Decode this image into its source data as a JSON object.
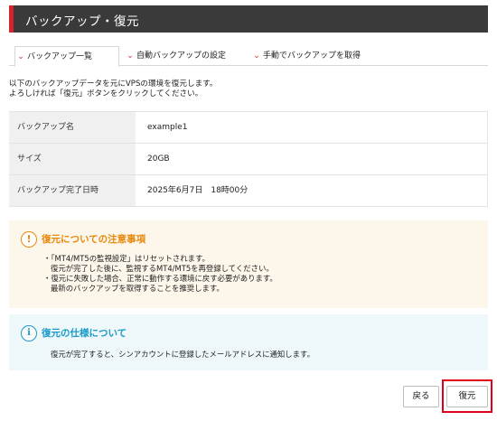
{
  "header": {
    "title": "バックアップ・復元"
  },
  "tabs": [
    {
      "label": "バックアップ一覧",
      "active": true
    },
    {
      "label": "自動バックアップの設定",
      "active": false
    },
    {
      "label": "手動でバックアップを取得",
      "active": false
    }
  ],
  "intro": {
    "line1": "以下のバックアップデータを元にVPSの環境を復元します。",
    "line2": "よろしければ「復元」ボタンをクリックしてください。"
  },
  "backup_info": {
    "rows": [
      {
        "label": "バックアップ名",
        "value": "example1"
      },
      {
        "label": "サイズ",
        "value": "20GB"
      },
      {
        "label": "バックアップ完了日時",
        "value": "2025年6月7日　18時00分"
      }
    ]
  },
  "notice": {
    "icon": "exclamation-icon",
    "title": "復元についての注意事項",
    "lines": [
      "・「MT4/MT5の監視設定」はリセットされます。",
      "復元が完了した後に、監視するMT4/MT5を再登録してください。",
      "・復元に失敗した場合、正常に動作する環境に戻す必要があります。",
      "最新のバックアップを取得することを推奨します。"
    ],
    "color": "#e8890c",
    "background": "#fdf6ea"
  },
  "spec": {
    "icon": "info-icon",
    "title": "復元の仕様について",
    "text": "復元が完了すると、シンアカウントに登録したメールアドレスに通知します。",
    "color": "#1a9ac9",
    "background": "#eef8fb"
  },
  "buttons": {
    "back": "戻る",
    "restore": "復元"
  },
  "colors": {
    "accent": "#d8232a",
    "header_bg": "#3a3a3a",
    "highlight": "#e0001b"
  }
}
